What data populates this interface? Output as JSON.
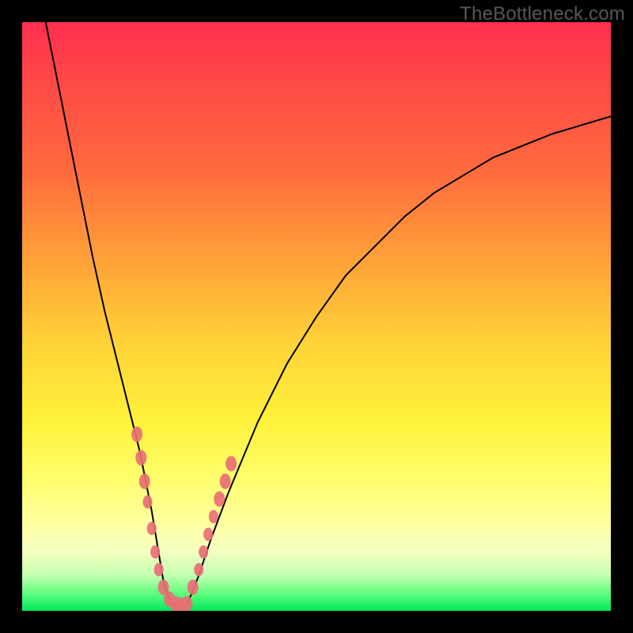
{
  "watermark": "TheBottleneck.com",
  "chart_data": {
    "type": "line",
    "title": "",
    "xlabel": "",
    "ylabel": "",
    "xlim": [
      0,
      100
    ],
    "ylim": [
      0,
      100
    ],
    "series": [
      {
        "name": "bottleneck-curve",
        "x": [
          4,
          6,
          8,
          10,
          12,
          14,
          16,
          18,
          20,
          22,
          23,
          24,
          25,
          26,
          28,
          30,
          32,
          35,
          40,
          45,
          50,
          55,
          60,
          65,
          70,
          75,
          80,
          85,
          90,
          95,
          100
        ],
        "y": [
          100,
          90,
          80,
          70,
          60,
          51,
          43,
          35,
          27,
          17,
          11,
          5,
          2,
          1,
          1,
          6,
          12,
          20,
          32,
          42,
          50,
          57,
          62,
          67,
          71,
          74,
          77,
          79,
          81,
          82.5,
          84
        ]
      }
    ],
    "markers": [
      {
        "x": 19.5,
        "y": 30,
        "size": 7
      },
      {
        "x": 20.2,
        "y": 26,
        "size": 7
      },
      {
        "x": 20.8,
        "y": 22,
        "size": 7
      },
      {
        "x": 21.3,
        "y": 18.5,
        "size": 6
      },
      {
        "x": 22.0,
        "y": 14,
        "size": 6
      },
      {
        "x": 22.6,
        "y": 10,
        "size": 6
      },
      {
        "x": 23.2,
        "y": 7,
        "size": 6
      },
      {
        "x": 24.0,
        "y": 4,
        "size": 7
      },
      {
        "x": 25.0,
        "y": 2,
        "size": 7
      },
      {
        "x": 26.0,
        "y": 1.2,
        "size": 7
      },
      {
        "x": 27.0,
        "y": 1,
        "size": 7
      },
      {
        "x": 28.0,
        "y": 1.2,
        "size": 7
      },
      {
        "x": 29.0,
        "y": 4,
        "size": 7
      },
      {
        "x": 30.0,
        "y": 7,
        "size": 6
      },
      {
        "x": 30.8,
        "y": 10,
        "size": 6
      },
      {
        "x": 31.6,
        "y": 13,
        "size": 6
      },
      {
        "x": 32.5,
        "y": 16,
        "size": 6
      },
      {
        "x": 33.5,
        "y": 19,
        "size": 7
      },
      {
        "x": 34.5,
        "y": 22,
        "size": 7
      },
      {
        "x": 35.5,
        "y": 25,
        "size": 7
      }
    ],
    "marker_color": "#e96f75",
    "curve_color": "#000000"
  }
}
